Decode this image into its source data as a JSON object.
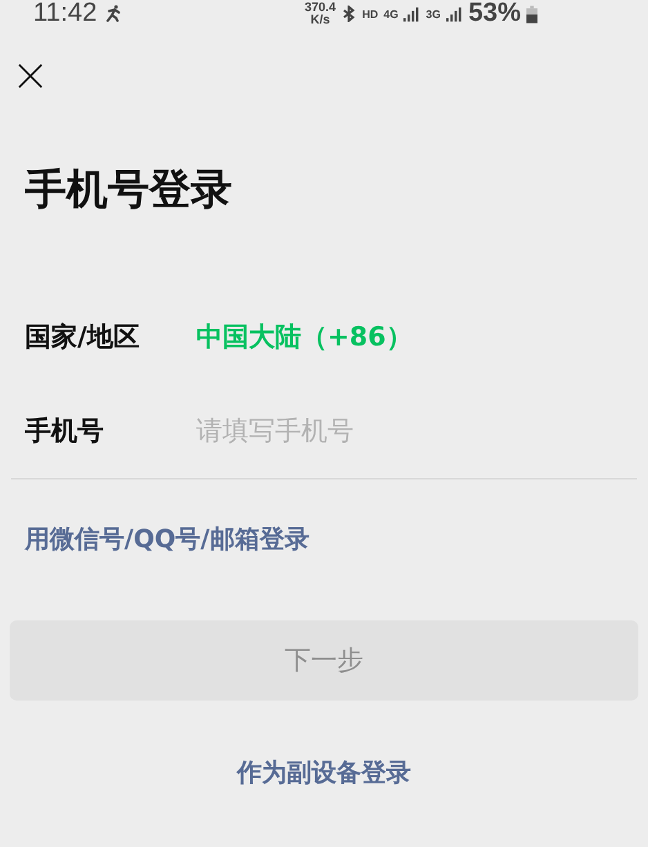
{
  "status_bar": {
    "time": "11:42",
    "speed": "370.4",
    "speed_unit": "K/s",
    "hd": "HD",
    "net_4g": "4G",
    "net_3g": "3G",
    "battery": "53%"
  },
  "title": "手机号登录",
  "fields": [
    {
      "label": "国家/地区",
      "kind": "select",
      "value": "中国大陆（+86）"
    },
    {
      "label": "手机号",
      "kind": "input",
      "placeholder": "请填写手机号"
    }
  ],
  "alt_login_link": "用微信号/QQ号/邮箱登录",
  "next_button": {
    "label": "下一步",
    "disabled": true
  },
  "secondary_device_link": "作为副设备登录"
}
